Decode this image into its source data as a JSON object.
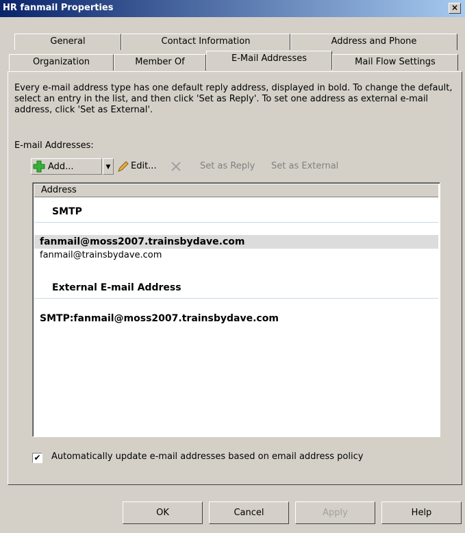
{
  "window": {
    "title": "HR fanmail Properties",
    "close": "×"
  },
  "tabs_row1": [
    "General",
    "Contact Information",
    "Address and Phone"
  ],
  "tabs_row2": [
    "Organization",
    "Member Of",
    "E-Mail Addresses",
    "Mail Flow Settings"
  ],
  "active_tab": "E-Mail Addresses",
  "description": "Every e-mail address type has one default reply address, displayed in bold. To change the default, select an entry in the list, and then click 'Set as Reply'. To set one address as external e-mail address, click 'Set as External'.",
  "email_label": "E-mail Addresses:",
  "toolbar": {
    "add": "Add...",
    "add_icon": "plus-icon",
    "dropdown": "▼",
    "edit": "Edit...",
    "edit_icon": "pencil-icon",
    "remove_icon": "x-icon",
    "set_reply": "Set as Reply",
    "set_external": "Set as External"
  },
  "list": {
    "header": "Address",
    "group1": "SMTP",
    "rows": [
      "fanmail@moss2007.trainsbydave.com",
      "fanmail@trainsbydave.com"
    ],
    "group2": "External E-mail Address",
    "external": "SMTP:fanmail@moss2007.trainsbydave.com"
  },
  "auto_update": {
    "checked": true,
    "mark": "✔",
    "label": "Automatically update e-mail addresses based on email address policy"
  },
  "buttons": {
    "ok": "OK",
    "cancel": "Cancel",
    "apply": "Apply",
    "help": "Help"
  },
  "colors": {
    "titlebar_start": "#0a246a",
    "titlebar_end": "#a6caf0",
    "face": "#d4d0c8"
  }
}
